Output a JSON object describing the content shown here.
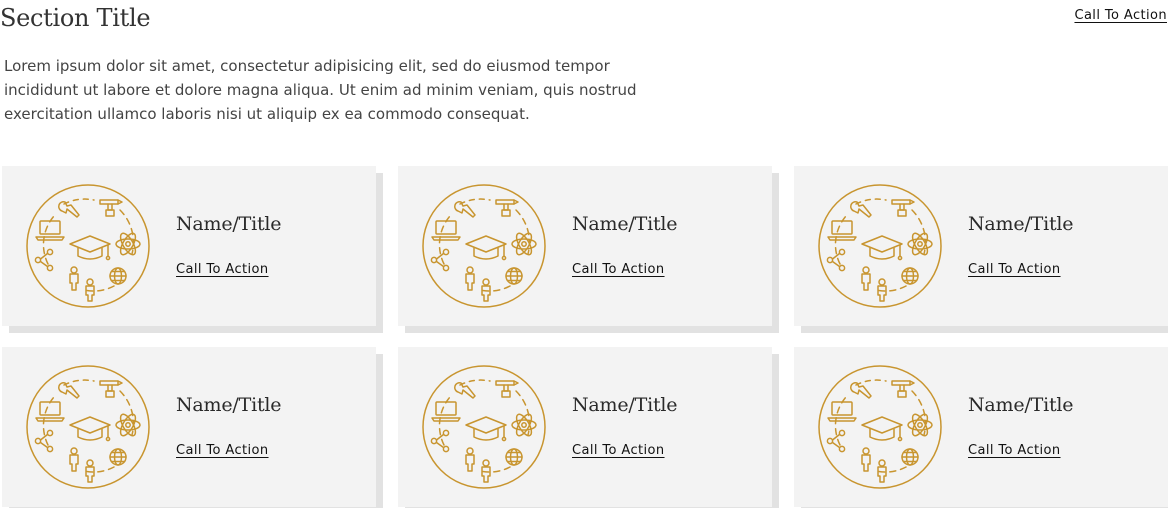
{
  "header": {
    "title": "Section Title",
    "cta_label": "Call To Action"
  },
  "intro": {
    "text": "Lorem ipsum dolor sit amet, consectetur adipisicing elit, sed do eiusmod tempor incididunt ut labore et dolore magna aliqua. Ut enim ad minim veniam, quis nostrud exercitation ullamco laboris nisi ut aliquip ex ea commodo consequat."
  },
  "cards": [
    {
      "title": "Name/Title",
      "cta_label": "Call To Action",
      "icon": "education-emblem-icon"
    },
    {
      "title": "Name/Title",
      "cta_label": "Call To Action",
      "icon": "education-emblem-icon"
    },
    {
      "title": "Name/Title",
      "cta_label": "Call To Action",
      "icon": "education-emblem-icon"
    },
    {
      "title": "Name/Title",
      "cta_label": "Call To Action",
      "icon": "education-emblem-icon"
    },
    {
      "title": "Name/Title",
      "cta_label": "Call To Action",
      "icon": "education-emblem-icon"
    },
    {
      "title": "Name/Title",
      "cta_label": "Call To Action",
      "icon": "education-emblem-icon"
    }
  ],
  "colors": {
    "accent": "#c8952f",
    "card_background": "#f3f3f3",
    "card_shadow": "#e2e2e2",
    "text": "#2b2b2b"
  }
}
